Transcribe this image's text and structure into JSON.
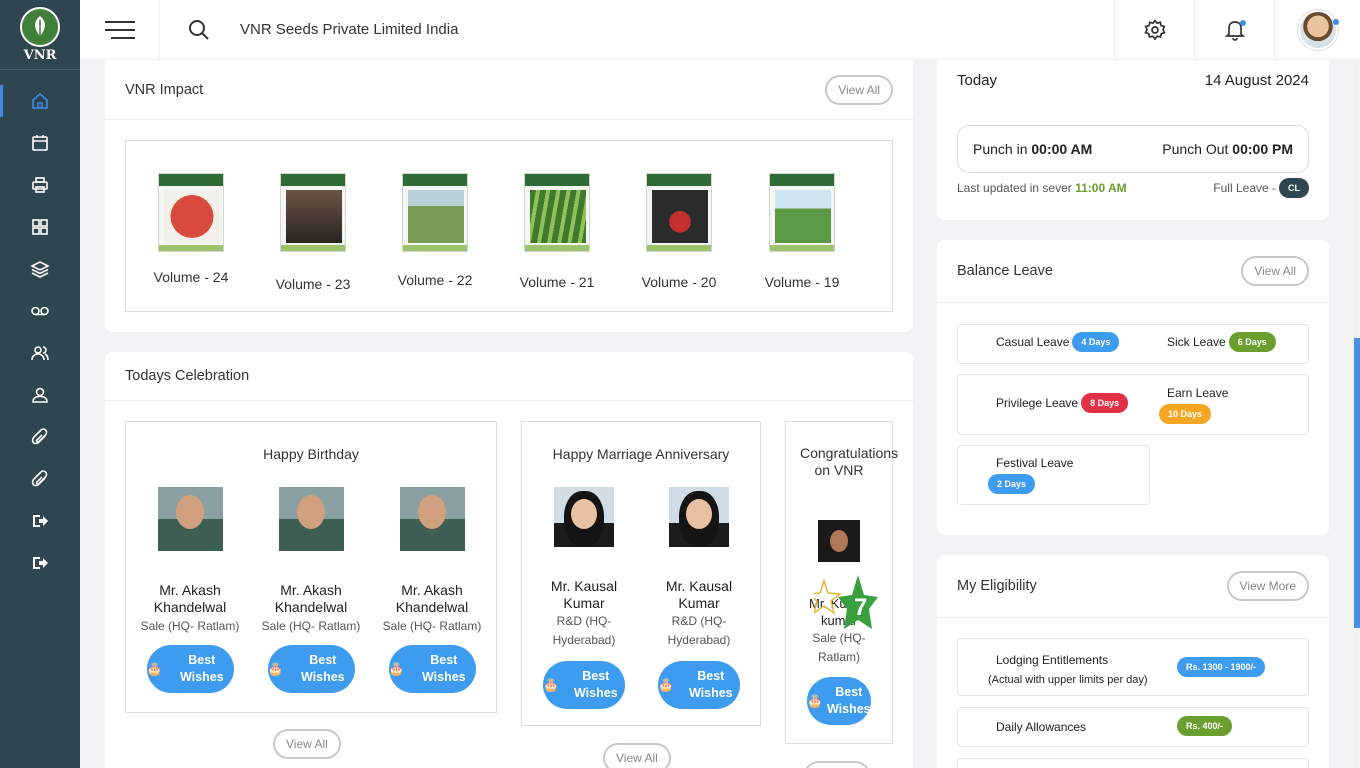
{
  "app": {
    "logo_text": "VNR",
    "company": "VNR Seeds Private Limited India"
  },
  "sidebar": {
    "items": [
      {
        "name": "home-icon",
        "active": true
      },
      {
        "name": "calendar-icon"
      },
      {
        "name": "printer-icon"
      },
      {
        "name": "grid-icon"
      },
      {
        "name": "layers-icon"
      },
      {
        "name": "voicemail-icon"
      },
      {
        "name": "users-icon"
      },
      {
        "name": "user-icon"
      },
      {
        "name": "paperclip-icon"
      },
      {
        "name": "attachment-icon"
      },
      {
        "name": "logout-icon"
      },
      {
        "name": "signout-icon"
      }
    ]
  },
  "impact": {
    "title": "VNR Impact",
    "view_all": "View All",
    "volumes": [
      {
        "label": "Volume - 24",
        "color": "#c9473f"
      },
      {
        "label": "Volume - 23",
        "color": "#4a3a30"
      },
      {
        "label": "Volume - 22",
        "color": "#7a9a58"
      },
      {
        "label": "Volume - 21",
        "color": "#6ba046"
      },
      {
        "label": "Volume - 20",
        "color": "#2c2c2c"
      },
      {
        "label": "Volume - 19",
        "color": "#5c9a45"
      }
    ]
  },
  "celebration": {
    "title": "Todays Celebration",
    "birthday": {
      "title": "Happy Birthday",
      "view_all": "View All",
      "people": [
        {
          "name": "Mr. Akash Khandelwal",
          "dept": "Sale (HQ- Ratlam)",
          "wish": "Best Wishes"
        },
        {
          "name": "Mr. Akash Khandelwal",
          "dept": "Sale (HQ- Ratlam)",
          "wish": "Best Wishes"
        },
        {
          "name": "Mr. Akash Khandelwal",
          "dept": "Sale (HQ- Ratlam)",
          "wish": "Best Wishes"
        }
      ]
    },
    "anniversary": {
      "title": "Happy Marriage Anniversary",
      "view_all": "View All",
      "people": [
        {
          "name": "Mr. Kausal Kumar",
          "dept": "R&D (HQ- Hyderabad)",
          "wish": "Best Wishes"
        },
        {
          "name": "Mr. Kausal Kumar",
          "dept": "R&D (HQ- Hyderabad)",
          "wish": "Best Wishes"
        }
      ]
    },
    "congrats": {
      "title": "Congratulations on VNR",
      "name": "Mr. Kumar kumar",
      "dept": "Sale (HQ- Ratlam)",
      "years": "7",
      "wish": "Best Wishes"
    }
  },
  "today": {
    "label": "Today",
    "date": "14 August 2024",
    "punch_in_label": "Punch in",
    "punch_in": "00:00 AM",
    "punch_out_label": "Punch Out",
    "punch_out": "00:00 PM",
    "updated_label": "Last updated in sever",
    "updated_time": "11:00 AM",
    "leave_status": "Full Leave -",
    "leave_code": "CL"
  },
  "balance": {
    "title": "Balance Leave",
    "view_all": "View All",
    "items": [
      {
        "label": "Casual Leave",
        "value": "4 Days",
        "color": "#3d9bf0"
      },
      {
        "label": "Sick Leave",
        "value": "6 Days",
        "color": "#6a9e2f"
      },
      {
        "label": "Privilege Leave",
        "value": "8 Days",
        "color": "#e03145"
      },
      {
        "label": "Earn Leave",
        "value": "10 Days",
        "color": "#f5a623"
      },
      {
        "label": "Festival Leave",
        "value": "2 Days",
        "color": "#3d9bf0"
      }
    ]
  },
  "eligibility": {
    "title": "My Eligibility",
    "view_more": "View More",
    "items": [
      {
        "label": "Lodging Entitlements",
        "sub": "(Actual with upper limits per day)",
        "value": "Rs. 1300 - 1900/-",
        "color": "#3d9bf0"
      },
      {
        "label": "Daily Allowances",
        "value": "Rs. 400/-",
        "color": "#6a9e2f"
      }
    ]
  }
}
